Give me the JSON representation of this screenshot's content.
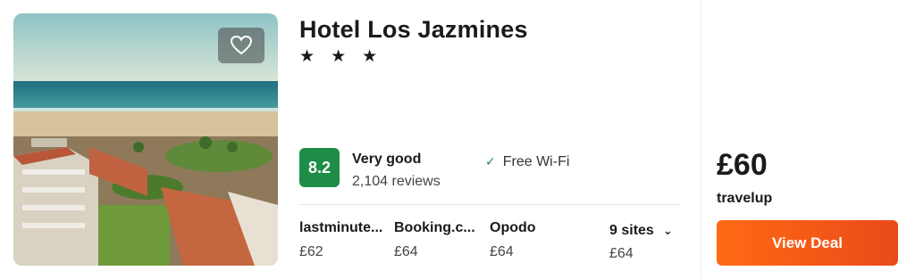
{
  "hotel": {
    "name": "Hotel Los Jazmines",
    "stars": "★ ★ ★",
    "photo_icon": "hotel-photo"
  },
  "favorite": {
    "icon": "heart-icon"
  },
  "rating": {
    "score": "8.2",
    "label": "Very good",
    "reviews": "2,104 reviews",
    "badge_color": "#1e8d47"
  },
  "amenities": [
    {
      "icon": "check-icon",
      "label": "Free Wi-Fi"
    }
  ],
  "deals": [
    {
      "site": "lastminute...",
      "price": "£62"
    },
    {
      "site": "Booking.c...",
      "price": "£64"
    },
    {
      "site": "Opodo",
      "price": "£64"
    }
  ],
  "more_sites": {
    "label": "9 sites",
    "price": "£64",
    "icon": "chevron-down-icon"
  },
  "best_deal": {
    "price": "£60",
    "provider": "travelup",
    "button_label": "View Deal",
    "button_color": "#ff6a13"
  }
}
